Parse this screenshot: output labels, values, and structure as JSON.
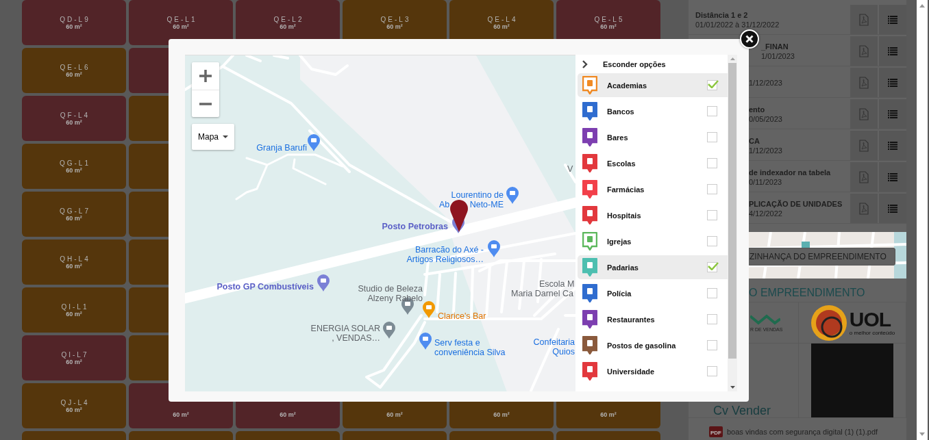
{
  "lot_rows": [
    [
      {
        "label": "QD-L9",
        "area": "60 m²",
        "color": "#522428"
      },
      {
        "label": "QE-L1",
        "area": "60 m²",
        "color": "#522428"
      },
      {
        "label": "QE-L2",
        "area": "60 m²",
        "color": "#522428"
      },
      {
        "label": "QE-L3",
        "area": "60 m²",
        "color": "#55360c"
      },
      {
        "label": "QE-L4",
        "area": "60 m²",
        "color": "#55360c"
      },
      {
        "label": "QE-L5",
        "area": "60 m²",
        "color": "#522428"
      }
    ],
    [
      {
        "label": "QE-L6",
        "area": "60 m²",
        "color": "#55360c"
      },
      {
        "color": "#522428"
      }
    ],
    [
      {
        "label": "QF-L4",
        "area": "60 m²",
        "color": "#522428"
      },
      {
        "color": "#55360c"
      }
    ],
    [
      {
        "label": "QG-L1",
        "area": "60 m²",
        "color": "#55360c"
      },
      {
        "color": "#55360c"
      }
    ],
    [
      {
        "label": "QG-L7",
        "area": "60 m²",
        "color": "#55360c"
      },
      {
        "color": "#55360c"
      }
    ],
    [
      {
        "label": "QH-L4",
        "area": "60 m²",
        "color": "#55360c"
      },
      {
        "color": "#55360c"
      }
    ],
    [
      {
        "label": "QI-L1",
        "area": "60 m²",
        "color": "#55360c"
      },
      {
        "color": "#55360c"
      }
    ],
    [
      {
        "label": "QI-L7",
        "area": "60 m²",
        "color": "#522428"
      },
      {
        "color": "#55360c"
      }
    ],
    [
      {
        "label": "QJ-L4",
        "area": "60 m²",
        "color": "#55360c"
      },
      {
        "area": "60 m²",
        "color": "#522428"
      },
      {
        "area": "60 m²",
        "color": "#522428"
      },
      {
        "area": "60 m²",
        "color": "#55360c"
      },
      {
        "area": "60 m²",
        "color": "#55360c"
      },
      {
        "area": "60 m²",
        "color": "#55360c"
      }
    ],
    [
      {
        "color": "#55360c"
      },
      {
        "color": "#55360c"
      },
      {
        "color": "#55360c"
      },
      {
        "color": "#55360c"
      },
      {
        "color": "#55360c"
      },
      {
        "color": "#55360c"
      }
    ]
  ],
  "documents": [
    {
      "title": "Distância 1 e 2",
      "period": "01/01/2022 à 31/12/2022"
    },
    {
      "title": "_FINAN",
      "period": "1/01/2023"
    },
    {
      "period": "1/12/2023"
    },
    {
      "title": "ento",
      "period": "0/05/2023"
    },
    {
      "title": "CA",
      "period": "1/12/2023"
    },
    {
      "title": "de indexador na tabela",
      "period": "0/11/2023"
    },
    {
      "title": "PLICAÇÃO DE UNIDADES",
      "period": "4/12/2022"
    }
  ],
  "neighborhood_button": "ZINHANÇA DO EMPREENDIMENTO",
  "section_heading": "O EMPREENDIMENTO",
  "partners": [
    {
      "kind": "zigzag",
      "caption": "R DE VENDAS"
    },
    {
      "kind": "uol",
      "name": "UOL",
      "tagline": "o melhor conteúdo"
    },
    {
      "kind": "text",
      "name": "Cv Vender"
    },
    {
      "kind": "video"
    }
  ],
  "attachment": {
    "badge": "PDF",
    "file": "boas vindas com segurança digital (1) (1).pdf"
  },
  "modal": {
    "map": {
      "map_type": "Mapa",
      "pois": [
        {
          "kind": "shop",
          "lines": [
            "Granja Barufi"
          ]
        },
        {
          "kind": "place",
          "lines": [
            "V"
          ]
        },
        {
          "kind": "shop",
          "lines": [
            "Lourentino de",
            "Ab",
            "Neto-ME"
          ]
        },
        {
          "kind": "gas",
          "lines": [
            "Posto Petrobras"
          ]
        },
        {
          "kind": "shop",
          "lines": [
            "Barracão do Axé -",
            "Artigos Religiosos…"
          ]
        },
        {
          "kind": "gas",
          "lines": [
            "Posto GP Combustíveis"
          ]
        },
        {
          "kind": "place",
          "lines": [
            "Studio de Beleza",
            "Alzeny Rabelo"
          ]
        },
        {
          "kind": "bar",
          "lines": [
            "Clarice's Bar"
          ]
        },
        {
          "kind": "place",
          "lines": [
            "ENERGIA SOLAR",
            ", VENDAS…"
          ]
        },
        {
          "kind": "shop",
          "lines": [
            "Serv festa e",
            "conveniência Silva"
          ]
        },
        {
          "kind": "place",
          "lines": [
            "Escola M",
            "Maria Darnel Ca"
          ]
        },
        {
          "kind": "shop",
          "lines": [
            "Confeitaria",
            "Quios"
          ]
        }
      ]
    },
    "options_toggle": "Esconder opções",
    "categories": [
      {
        "name": "Academias",
        "checked": true,
        "color": "#f08a24",
        "outlined": true
      },
      {
        "name": "Bancos",
        "checked": false,
        "color": "#2f6ccf",
        "outlined": false
      },
      {
        "name": "Bares",
        "checked": false,
        "color": "#7d3fb0",
        "outlined": false
      },
      {
        "name": "Escolas",
        "checked": false,
        "color": "#e2383d",
        "outlined": false
      },
      {
        "name": "Farmácias",
        "checked": false,
        "color": "#f2404a",
        "outlined": false
      },
      {
        "name": "Hospitais",
        "checked": false,
        "color": "#e2383d",
        "outlined": false
      },
      {
        "name": "Igrejas",
        "checked": false,
        "color": "#5cb85c",
        "outlined": true
      },
      {
        "name": "Padarias",
        "checked": true,
        "color": "#4dbfb0",
        "outlined": false
      },
      {
        "name": "Polícia",
        "checked": false,
        "color": "#2f6ccf",
        "outlined": false
      },
      {
        "name": "Restaurantes",
        "checked": false,
        "color": "#7d3fb0",
        "outlined": false
      },
      {
        "name": "Postos de gasolina",
        "checked": false,
        "color": "#8a5a3c",
        "outlined": false
      },
      {
        "name": "Universidade",
        "checked": false,
        "color": "#e2383d",
        "outlined": false
      }
    ]
  }
}
